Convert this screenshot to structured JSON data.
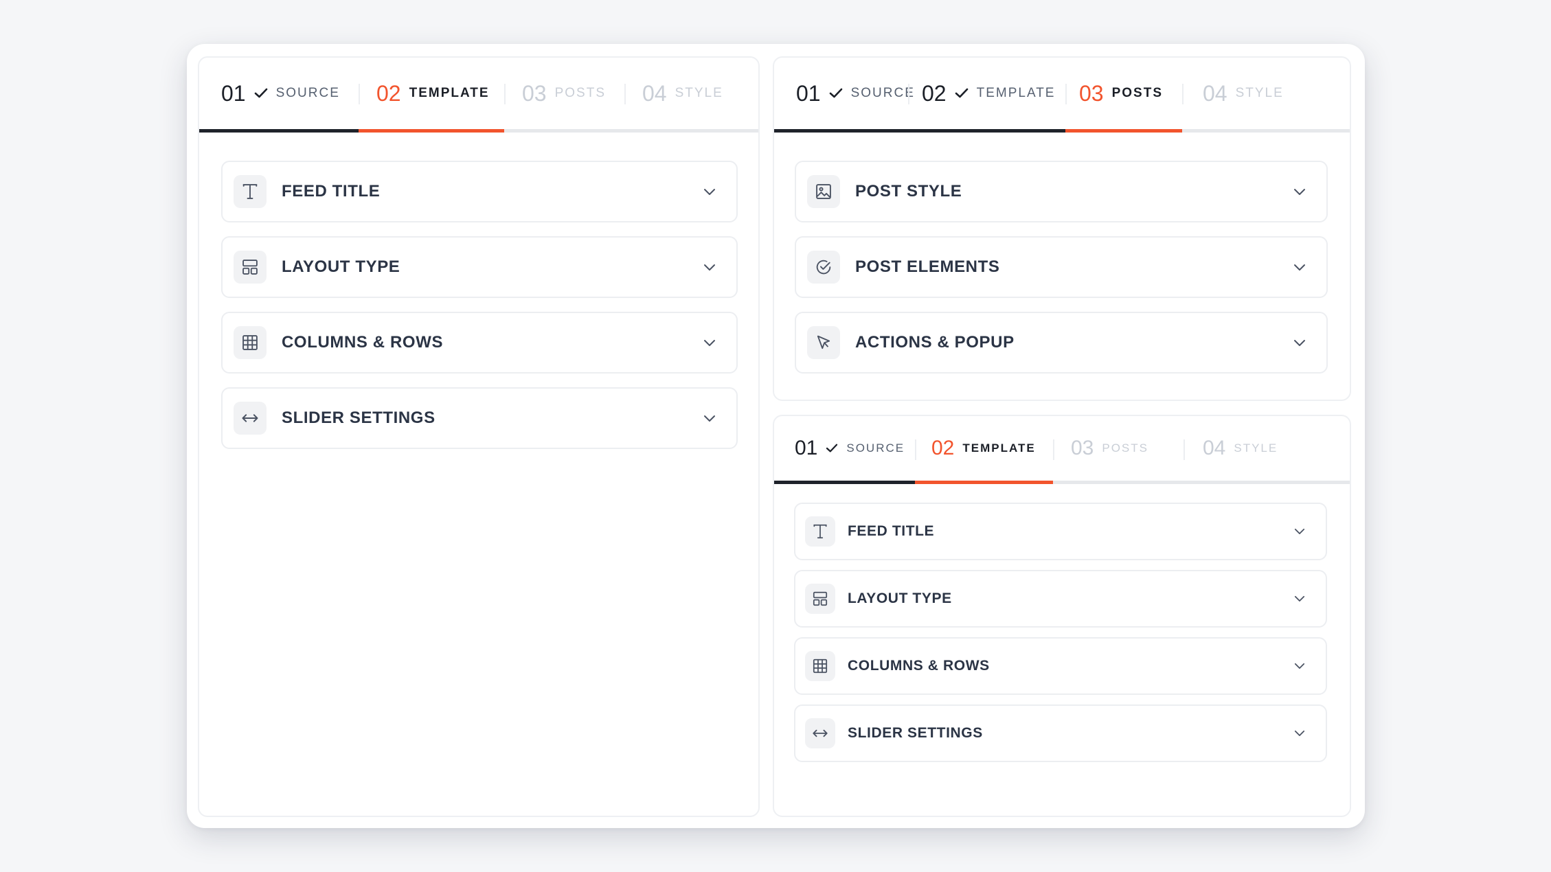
{
  "panels": {
    "left": {
      "tabs": [
        {
          "num": "01",
          "label": "SOURCE",
          "state": "done"
        },
        {
          "num": "02",
          "label": "TEMPLATE",
          "state": "active"
        },
        {
          "num": "03",
          "label": "POSTS",
          "state": "upcoming"
        },
        {
          "num": "04",
          "label": "STYLE",
          "state": "upcoming"
        }
      ],
      "rows": [
        {
          "label": "FEED TITLE",
          "icon": "text-icon"
        },
        {
          "label": "LAYOUT TYPE",
          "icon": "layout-icon"
        },
        {
          "label": "COLUMNS & ROWS",
          "icon": "grid-icon"
        },
        {
          "label": "SLIDER SETTINGS",
          "icon": "arrows-horizontal-icon"
        }
      ]
    },
    "top_right": {
      "tabs": [
        {
          "num": "01",
          "label": "SOURCE",
          "state": "done"
        },
        {
          "num": "02",
          "label": "TEMPLATE",
          "state": "done"
        },
        {
          "num": "03",
          "label": "POSTS",
          "state": "active"
        },
        {
          "num": "04",
          "label": "STYLE",
          "state": "upcoming"
        }
      ],
      "rows": [
        {
          "label": "POST STYLE",
          "icon": "image-icon"
        },
        {
          "label": "POST ELEMENTS",
          "icon": "check-circle-icon"
        },
        {
          "label": "ACTIONS & POPUP",
          "icon": "cursor-icon"
        }
      ]
    },
    "bottom_right": {
      "tabs": [
        {
          "num": "01",
          "label": "SOURCE",
          "state": "done"
        },
        {
          "num": "02",
          "label": "TEMPLATE",
          "state": "active"
        },
        {
          "num": "03",
          "label": "POSTS",
          "state": "upcoming"
        },
        {
          "num": "04",
          "label": "STYLE",
          "state": "upcoming"
        }
      ],
      "rows": [
        {
          "label": "FEED TITLE",
          "icon": "text-icon"
        },
        {
          "label": "LAYOUT TYPE",
          "icon": "layout-icon"
        },
        {
          "label": "COLUMNS & ROWS",
          "icon": "grid-icon"
        },
        {
          "label": "SLIDER SETTINGS",
          "icon": "arrows-horizontal-icon"
        }
      ]
    }
  },
  "colors": {
    "accent": "#f2542d",
    "completed_underline": "#1f232b",
    "text": "#2b3445",
    "muted": "#c9ced6",
    "border": "#eceef1"
  }
}
